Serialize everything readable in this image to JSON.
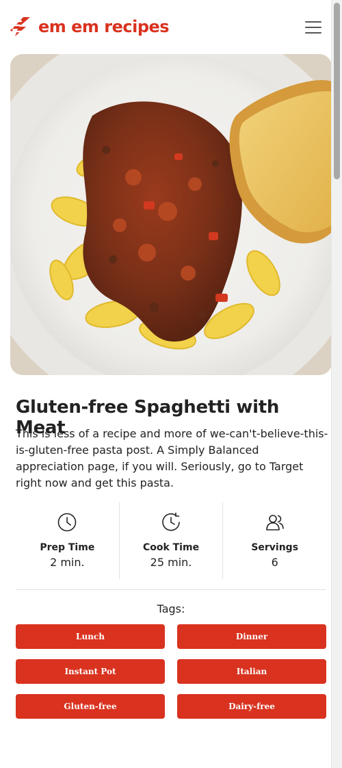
{
  "brand": {
    "name": "em em recipes",
    "color": "#d9321f",
    "logo_icon": "lightning-logo-icon"
  },
  "nav": {
    "menu_icon": "hamburger-menu-icon"
  },
  "recipe": {
    "title": "Gluten-free Spaghetti with Meat",
    "description": "This is less of a recipe and more of we-can't-believe-this-is-gluten-free pasta post. A Simply Balanced appreciation page, if you will. Seriously, go to Target right now and get this pasta.",
    "image_alt": "Rotini pasta with meat sauce and garlic bread in a white bowl"
  },
  "stats": [
    {
      "icon": "clock-icon",
      "label": "Prep Time",
      "value": "2 min."
    },
    {
      "icon": "clock-refresh-icon",
      "label": "Cook Time",
      "value": "25 min."
    },
    {
      "icon": "users-icon",
      "label": "Servings",
      "value": "6"
    }
  ],
  "tags": {
    "title": "Tags:",
    "items": [
      "Lunch",
      "Dinner",
      "Instant Pot",
      "Italian",
      "Gluten-free",
      "Dairy-free"
    ]
  }
}
